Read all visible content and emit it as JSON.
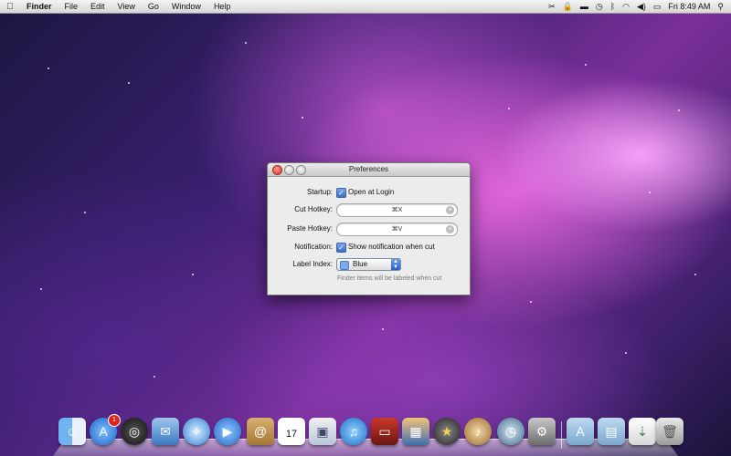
{
  "menubar": {
    "app": "Finder",
    "items": [
      "File",
      "Edit",
      "View",
      "Go",
      "Window",
      "Help"
    ],
    "clock": "Fri 8:49 AM"
  },
  "window": {
    "title": "Preferences",
    "startup": {
      "label": "Startup:",
      "checkbox": "Open at Login",
      "checked": true
    },
    "cut_hotkey": {
      "label": "Cut Hotkey:",
      "value": "⌘X"
    },
    "paste_hotkey": {
      "label": "Paste Hotkey:",
      "value": "⌘V"
    },
    "notification": {
      "label": "Notification:",
      "checkbox": "Show notification when cut",
      "checked": true
    },
    "label_index": {
      "label": "Label Index:",
      "selected": "Blue",
      "swatch_color": "#7aa9ef"
    },
    "hint": "Finder items will be labeled when cut"
  },
  "dock": {
    "badge_app_store": "1",
    "calendar_day": "17",
    "icons": [
      "finder-icon",
      "app-store-icon",
      "dashboard-icon",
      "mail-icon",
      "safari-icon",
      "facetime-icon",
      "address-book-icon",
      "ical-icon",
      "preview-icon",
      "itunes-icon",
      "photo-booth-icon",
      "iphoto-icon",
      "imovie-icon",
      "garageband-icon",
      "time-machine-icon",
      "system-preferences-icon",
      "applications-folder-icon",
      "documents-folder-icon",
      "downloads-stack-icon",
      "trash-icon"
    ]
  }
}
